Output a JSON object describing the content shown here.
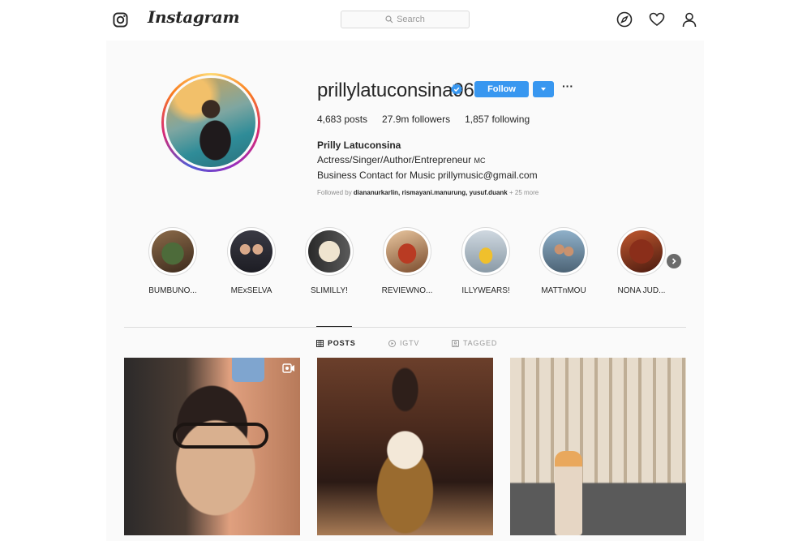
{
  "nav": {
    "wordmark": "Instagram",
    "search_placeholder": "Search",
    "icons": [
      "instagram-glyph-icon",
      "explore-compass-icon",
      "heart-icon",
      "profile-icon"
    ]
  },
  "profile": {
    "username": "prillylatuconsina96",
    "verified": true,
    "follow_label": "Follow",
    "more_label": "···",
    "stats": {
      "posts": "4,683 posts",
      "followers": "27.9m followers",
      "following": "1,857 following"
    },
    "bio": {
      "name": "Prilly Latuconsina",
      "line1": "Actress/Singer/Author/Entrepreneur",
      "line1_suffix": "MC",
      "line2": "Business Contact for Music prillymusic@gmail.com"
    },
    "followed_by": {
      "prefix": "Followed by",
      "names": "diananurkarlin, rismayani.manurung, yusuf.duank",
      "more": "+ 25 more"
    },
    "accent_color": "#3897f0"
  },
  "highlights": [
    {
      "label": "BUMBUNO..."
    },
    {
      "label": "MExSELVA"
    },
    {
      "label": "SLIMILLY!"
    },
    {
      "label": "REVIEWNO..."
    },
    {
      "label": "ILLYWEARS!"
    },
    {
      "label": "MATTnMOU"
    },
    {
      "label": "NONA JUD..."
    }
  ],
  "tabs": [
    {
      "label": "POSTS",
      "active": true,
      "icon": "grid-icon"
    },
    {
      "label": "IGTV",
      "active": false,
      "icon": "igtv-icon"
    },
    {
      "label": "TAGGED",
      "active": false,
      "icon": "tagged-icon"
    }
  ],
  "posts": [
    {
      "kind": "video"
    },
    {
      "kind": "photo"
    },
    {
      "kind": "photo"
    }
  ]
}
